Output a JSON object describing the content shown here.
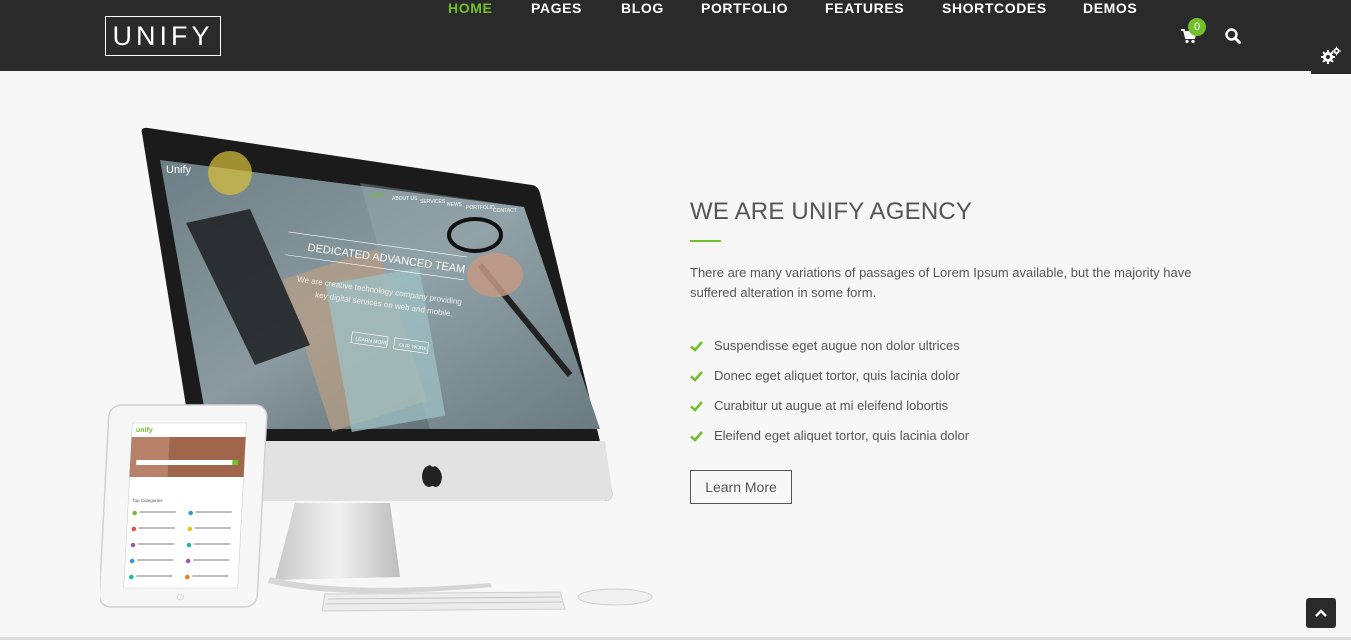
{
  "header": {
    "logo_text": "UNIFY",
    "nav": [
      {
        "label": "HOME",
        "active": true
      },
      {
        "label": "PAGES",
        "active": false
      },
      {
        "label": "BLOG",
        "active": false
      },
      {
        "label": "PORTFOLIO",
        "active": false
      },
      {
        "label": "FEATURES",
        "active": false
      },
      {
        "label": "SHORTCODES",
        "active": false
      },
      {
        "label": "DEMOS",
        "active": false
      }
    ],
    "cart_count": "0"
  },
  "hero": {
    "mockup": {
      "screen_logo": "Unify",
      "screen_nav": [
        "HOME",
        "ABOUT US",
        "SERVICES",
        "NEWS",
        "PORTFOLIO",
        "CONTACT"
      ],
      "screen_heading": "DEDICATED ADVANCED TEAM",
      "screen_text_1": "We are creative technology company providing",
      "screen_text_2": "key digital services on web and mobile.",
      "screen_btn_1": "LEARN MORE",
      "screen_btn_2": "OUR WORK",
      "tablet_logo": "unify",
      "tablet_categories_title": "Top Categories"
    },
    "title": "WE ARE UNIFY AGENCY",
    "description": "There are many variations of passages of Lorem Ipsum available, but the majority have suffered alteration in some form.",
    "features": [
      "Suspendisse eget augue non dolor ultrices",
      "Donec eget aliquet tortor, quis lacinia dolor",
      "Curabitur ut augue at mi eleifend lobortis",
      "Eleifend eget aliquet tortor, quis lacinia dolor"
    ],
    "cta_label": "Learn More"
  },
  "colors": {
    "accent": "#72c02c",
    "navbar": "#2a2a2a",
    "background": "#f7f7f7",
    "text": "#555555"
  },
  "icons": {
    "cart": "shopping-cart-icon",
    "search": "search-icon",
    "settings": "gears-icon",
    "check": "check-icon",
    "scroll_top": "chevron-up-icon"
  }
}
